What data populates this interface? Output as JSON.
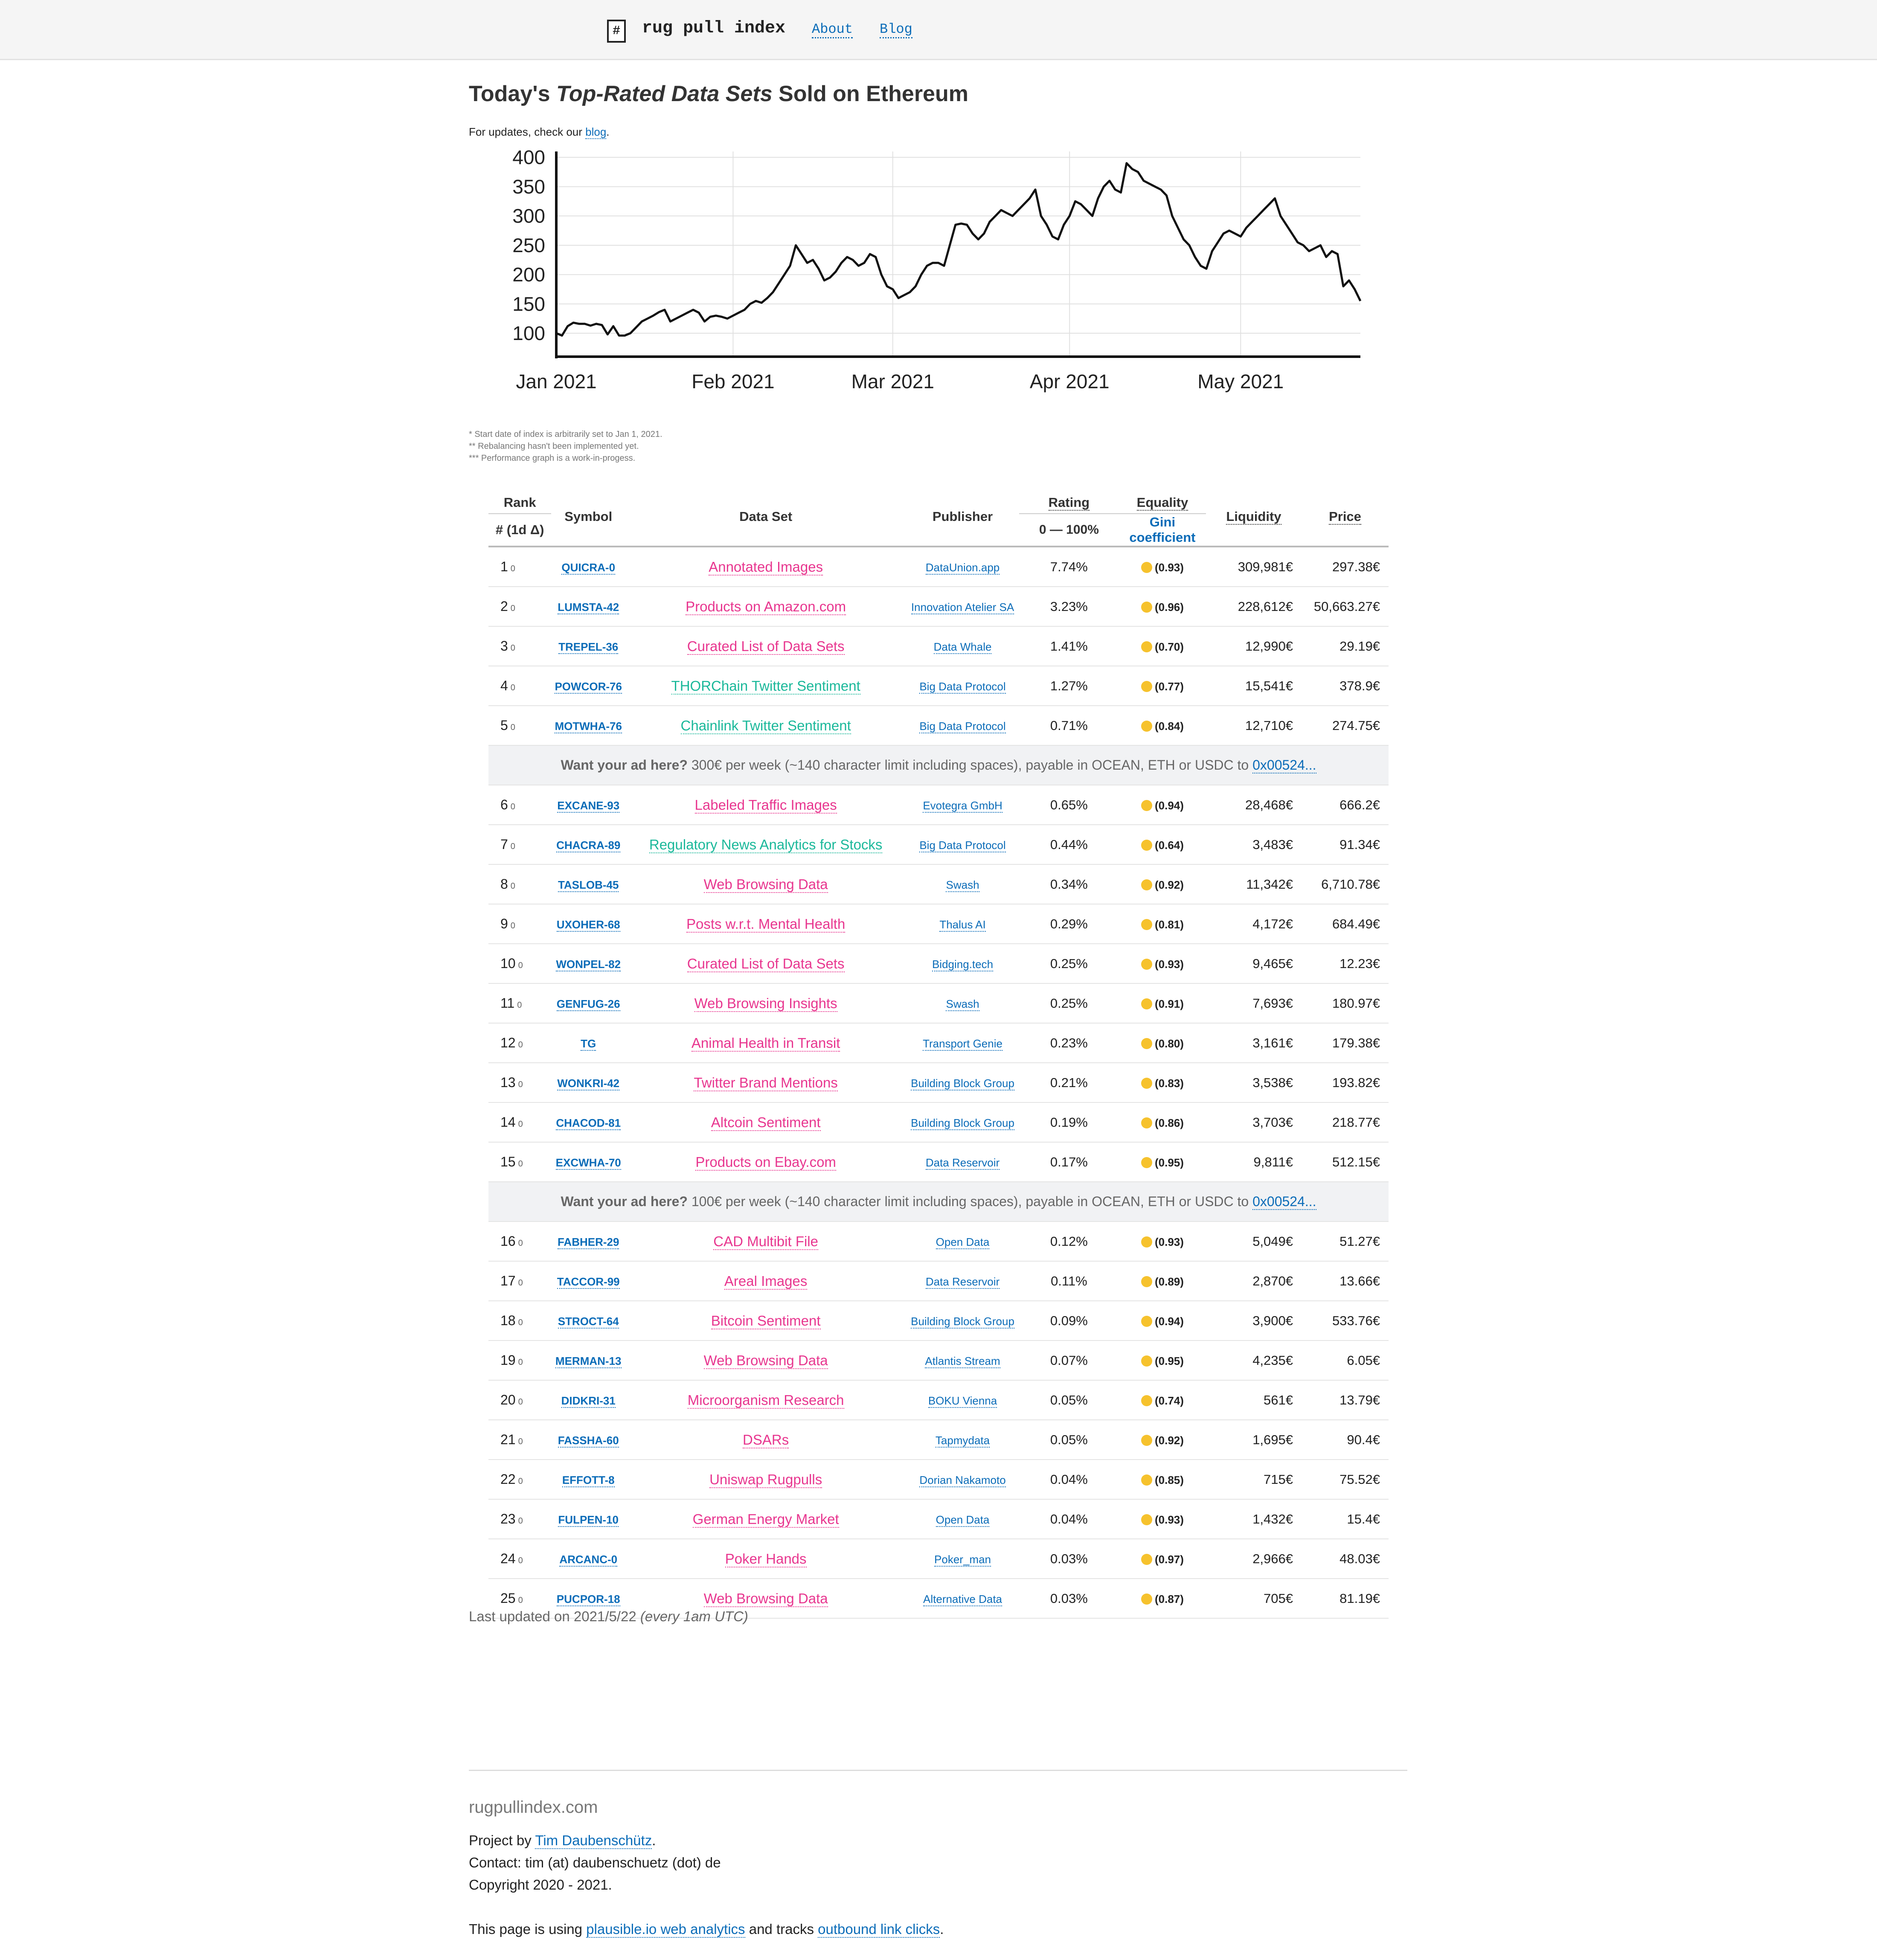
{
  "header": {
    "logo_glyph": "#",
    "brand": "rug pull index",
    "nav": [
      "About",
      "Blog"
    ]
  },
  "title": {
    "pre": "Today's ",
    "em": "Top-Rated Data Sets",
    "post": " Sold on Ethereum"
  },
  "updates": {
    "pre": "For updates, check our ",
    "link": "blog",
    "post": "."
  },
  "chart_data": {
    "type": "line",
    "title": "",
    "xlabel": "",
    "ylabel": "",
    "ylim": [
      60,
      410
    ],
    "yticks": [
      100,
      150,
      200,
      250,
      300,
      350,
      400
    ],
    "xticks": [
      {
        "label": "Jan 2021",
        "day": 0
      },
      {
        "label": "Feb 2021",
        "day": 31
      },
      {
        "label": "Mar 2021",
        "day": 59
      },
      {
        "label": "Apr 2021",
        "day": 90
      },
      {
        "label": "May 2021",
        "day": 120
      }
    ],
    "grid": true,
    "series": [
      {
        "name": "",
        "x": [
          0,
          1,
          2,
          3,
          4,
          5,
          6,
          7,
          8,
          9,
          10,
          11,
          12,
          13,
          14,
          15,
          16,
          17,
          18,
          19,
          20,
          21,
          22,
          23,
          24,
          25,
          26,
          27,
          28,
          29,
          30,
          31,
          32,
          33,
          34,
          35,
          36,
          37,
          38,
          39,
          40,
          41,
          42,
          43,
          44,
          45,
          46,
          47,
          48,
          49,
          50,
          51,
          52,
          53,
          54,
          55,
          56,
          57,
          58,
          59,
          60,
          61,
          62,
          63,
          64,
          65,
          66,
          67,
          68,
          69,
          70,
          71,
          72,
          73,
          74,
          75,
          76,
          77,
          78,
          79,
          80,
          81,
          82,
          83,
          84,
          85,
          86,
          87,
          88,
          89,
          90,
          91,
          92,
          93,
          94,
          95,
          96,
          97,
          98,
          99,
          100,
          101,
          102,
          103,
          104,
          105,
          106,
          107,
          108,
          109,
          110,
          111,
          112,
          113,
          114,
          115,
          116,
          117,
          118,
          119,
          120,
          121,
          122,
          123,
          124,
          125,
          126,
          127,
          128,
          129,
          130,
          131,
          132,
          133,
          134,
          135,
          136,
          137,
          138,
          139,
          140,
          141
        ],
        "y": [
          100,
          96,
          112,
          118,
          116,
          116,
          113,
          116,
          114,
          98,
          112,
          96,
          96,
          100,
          110,
          120,
          125,
          130,
          136,
          140,
          120,
          125,
          130,
          135,
          140,
          135,
          120,
          128,
          130,
          128,
          125,
          130,
          135,
          140,
          150,
          155,
          152,
          160,
          170,
          185,
          200,
          215,
          250,
          235,
          220,
          225,
          210,
          190,
          195,
          205,
          220,
          230,
          225,
          215,
          220,
          235,
          230,
          200,
          180,
          175,
          160,
          165,
          170,
          180,
          200,
          215,
          220,
          220,
          215,
          250,
          285,
          287,
          285,
          270,
          260,
          270,
          290,
          300,
          310,
          305,
          300,
          310,
          320,
          330,
          345,
          300,
          285,
          265,
          260,
          285,
          300,
          325,
          320,
          310,
          300,
          330,
          350,
          360,
          345,
          340,
          390,
          380,
          375,
          360,
          355,
          350,
          345,
          335,
          300,
          280,
          260,
          250,
          230,
          215,
          210,
          240,
          255,
          270,
          275,
          270,
          265,
          280,
          290,
          300,
          310,
          320,
          330,
          300,
          285,
          270,
          255,
          250,
          240,
          245,
          250,
          230,
          240,
          235,
          180,
          190,
          175,
          155
        ]
      }
    ]
  },
  "notes": [
    "* Start date of index is arbitrarily set to Jan 1, 2021.",
    "** Rebalancing hasn't been implemented yet.",
    "*** Performance graph is a work-in-progess."
  ],
  "table": {
    "headers": {
      "rank": "Rank",
      "rank_sub": "# (1d Δ)",
      "symbol": "Symbol",
      "dataset": "Data Set",
      "publisher": "Publisher",
      "rating": "Rating",
      "rating_sub": "0 — 100%",
      "equality": "Equality",
      "equality_sub": "Gini coefficient",
      "liquidity": "Liquidity",
      "price": "Price"
    },
    "colors": {
      "pink": "#e8368f",
      "teal": "#1ab89a"
    },
    "rows": [
      {
        "rank": "1",
        "delta": "0",
        "symbol": "QUICRA-0",
        "dataset": "Annotated Images",
        "color": "pink",
        "publisher": "DataUnion.app",
        "rating": "7.74%",
        "gini": "(0.93)",
        "liquidity": "309,981€",
        "price": "297.38€"
      },
      {
        "rank": "2",
        "delta": "0",
        "symbol": "LUMSTA-42",
        "dataset": "Products on Amazon.com",
        "color": "pink",
        "publisher": "Innovation Atelier SA",
        "rating": "3.23%",
        "gini": "(0.96)",
        "liquidity": "228,612€",
        "price": "50,663.27€"
      },
      {
        "rank": "3",
        "delta": "0",
        "symbol": "TREPEL-36",
        "dataset": "Curated List of Data Sets",
        "color": "pink",
        "publisher": "Data Whale",
        "rating": "1.41%",
        "gini": "(0.70)",
        "liquidity": "12,990€",
        "price": "29.19€"
      },
      {
        "rank": "4",
        "delta": "0",
        "symbol": "POWCOR-76",
        "dataset": "THORChain Twitter Sentiment",
        "color": "teal",
        "publisher": "Big Data Protocol",
        "rating": "1.27%",
        "gini": "(0.77)",
        "liquidity": "15,541€",
        "price": "378.9€"
      },
      {
        "rank": "5",
        "delta": "0",
        "symbol": "MOTWHA-76",
        "dataset": "Chainlink Twitter Sentiment",
        "color": "teal",
        "publisher": "Big Data Protocol",
        "rating": "0.71%",
        "gini": "(0.84)",
        "liquidity": "12,710€",
        "price": "274.75€"
      },
      {
        "ad": true,
        "ad_bold": "Want your ad here?",
        "ad_text": " 300€ per week (~140 character limit including spaces), payable in OCEAN, ETH or USDC to ",
        "ad_link": "0x00524..."
      },
      {
        "rank": "6",
        "delta": "0",
        "symbol": "EXCANE-93",
        "dataset": "Labeled Traffic Images",
        "color": "pink",
        "publisher": "Evotegra GmbH",
        "rating": "0.65%",
        "gini": "(0.94)",
        "liquidity": "28,468€",
        "price": "666.2€"
      },
      {
        "rank": "7",
        "delta": "0",
        "symbol": "CHACRA-89",
        "dataset": "Regulatory News Analytics for Stocks",
        "color": "teal",
        "publisher": "Big Data Protocol",
        "rating": "0.44%",
        "gini": "(0.64)",
        "liquidity": "3,483€",
        "price": "91.34€"
      },
      {
        "rank": "8",
        "delta": "0",
        "symbol": "TASLOB-45",
        "dataset": "Web Browsing Data",
        "color": "pink",
        "publisher": "Swash",
        "rating": "0.34%",
        "gini": "(0.92)",
        "liquidity": "11,342€",
        "price": "6,710.78€"
      },
      {
        "rank": "9",
        "delta": "0",
        "symbol": "UXOHER-68",
        "dataset": "Posts w.r.t. Mental Health",
        "color": "pink",
        "publisher": "Thalus AI",
        "rating": "0.29%",
        "gini": "(0.81)",
        "liquidity": "4,172€",
        "price": "684.49€"
      },
      {
        "rank": "10",
        "delta": "0",
        "symbol": "WONPEL-82",
        "dataset": "Curated List of Data Sets",
        "color": "pink",
        "publisher": "Bidging.tech",
        "rating": "0.25%",
        "gini": "(0.93)",
        "liquidity": "9,465€",
        "price": "12.23€"
      },
      {
        "rank": "11",
        "delta": "0",
        "symbol": "GENFUG-26",
        "dataset": "Web Browsing Insights",
        "color": "pink",
        "publisher": "Swash",
        "rating": "0.25%",
        "gini": "(0.91)",
        "liquidity": "7,693€",
        "price": "180.97€"
      },
      {
        "rank": "12",
        "delta": "0",
        "symbol": "TG",
        "dataset": "Animal Health in Transit",
        "color": "pink",
        "publisher": "Transport Genie",
        "rating": "0.23%",
        "gini": "(0.80)",
        "liquidity": "3,161€",
        "price": "179.38€"
      },
      {
        "rank": "13",
        "delta": "0",
        "symbol": "WONKRI-42",
        "dataset": "Twitter Brand Mentions",
        "color": "pink",
        "publisher": "Building Block Group",
        "rating": "0.21%",
        "gini": "(0.83)",
        "liquidity": "3,538€",
        "price": "193.82€"
      },
      {
        "rank": "14",
        "delta": "0",
        "symbol": "CHACOD-81",
        "dataset": "Altcoin Sentiment",
        "color": "pink",
        "publisher": "Building Block Group",
        "rating": "0.19%",
        "gini": "(0.86)",
        "liquidity": "3,703€",
        "price": "218.77€"
      },
      {
        "rank": "15",
        "delta": "0",
        "symbol": "EXCWHA-70",
        "dataset": "Products on Ebay.com",
        "color": "pink",
        "publisher": "Data Reservoir",
        "rating": "0.17%",
        "gini": "(0.95)",
        "liquidity": "9,811€",
        "price": "512.15€"
      },
      {
        "ad": true,
        "ad_bold": "Want your ad here?",
        "ad_text": " 100€ per week (~140 character limit including spaces), payable in OCEAN, ETH or USDC to ",
        "ad_link": "0x00524..."
      },
      {
        "rank": "16",
        "delta": "0",
        "symbol": "FABHER-29",
        "dataset": "CAD Multibit File",
        "color": "pink",
        "publisher": "Open Data",
        "rating": "0.12%",
        "gini": "(0.93)",
        "liquidity": "5,049€",
        "price": "51.27€"
      },
      {
        "rank": "17",
        "delta": "0",
        "symbol": "TACCOR-99",
        "dataset": "Areal Images",
        "color": "pink",
        "publisher": "Data Reservoir",
        "rating": "0.11%",
        "gini": "(0.89)",
        "liquidity": "2,870€",
        "price": "13.66€"
      },
      {
        "rank": "18",
        "delta": "0",
        "symbol": "STROCT-64",
        "dataset": "Bitcoin Sentiment",
        "color": "pink",
        "publisher": "Building Block Group",
        "rating": "0.09%",
        "gini": "(0.94)",
        "liquidity": "3,900€",
        "price": "533.76€"
      },
      {
        "rank": "19",
        "delta": "0",
        "symbol": "MERMAN-13",
        "dataset": "Web Browsing Data",
        "color": "pink",
        "publisher": "Atlantis Stream",
        "rating": "0.07%",
        "gini": "(0.95)",
        "liquidity": "4,235€",
        "price": "6.05€"
      },
      {
        "rank": "20",
        "delta": "0",
        "symbol": "DIDKRI-31",
        "dataset": "Microorganism Research",
        "color": "pink",
        "publisher": "BOKU Vienna",
        "rating": "0.05%",
        "gini": "(0.74)",
        "liquidity": "561€",
        "price": "13.79€"
      },
      {
        "rank": "21",
        "delta": "0",
        "symbol": "FASSHA-60",
        "dataset": "DSARs",
        "color": "pink",
        "publisher": "Tapmydata",
        "rating": "0.05%",
        "gini": "(0.92)",
        "liquidity": "1,695€",
        "price": "90.4€"
      },
      {
        "rank": "22",
        "delta": "0",
        "symbol": "EFFOTT-8",
        "dataset": "Uniswap Rugpulls",
        "color": "pink",
        "publisher": "Dorian Nakamoto",
        "rating": "0.04%",
        "gini": "(0.85)",
        "liquidity": "715€",
        "price": "75.52€"
      },
      {
        "rank": "23",
        "delta": "0",
        "symbol": "FULPEN-10",
        "dataset": "German Energy Market",
        "color": "pink",
        "publisher": "Open Data",
        "rating": "0.04%",
        "gini": "(0.93)",
        "liquidity": "1,432€",
        "price": "15.4€"
      },
      {
        "rank": "24",
        "delta": "0",
        "symbol": "ARCANC-0",
        "dataset": "Poker Hands",
        "color": "pink",
        "publisher": "Poker_man",
        "rating": "0.03%",
        "gini": "(0.97)",
        "liquidity": "2,966€",
        "price": "48.03€"
      },
      {
        "rank": "25",
        "delta": "0",
        "symbol": "PUCPOR-18",
        "dataset": "Web Browsing Data",
        "color": "pink",
        "publisher": "Alternative Data",
        "rating": "0.03%",
        "gini": "(0.87)",
        "liquidity": "705€",
        "price": "81.19€"
      }
    ]
  },
  "updated": {
    "text": "Last updated on 2021/5/22 ",
    "em": "(every 1am UTC)"
  },
  "footer": {
    "domain": "rugpullindex.com",
    "project_pre": "Project by ",
    "project_link": "Tim Daubenschütz",
    "project_post": ".",
    "contact": "Contact: tim (at) daubenschuetz (dot) de",
    "copyright": "Copyright 2020 - 2021.",
    "analytics_pre": "This page is using ",
    "analytics_link": "plausible.io web analytics",
    "analytics_mid": " and tracks ",
    "analytics_link2": "outbound link clicks",
    "analytics_post": "."
  }
}
